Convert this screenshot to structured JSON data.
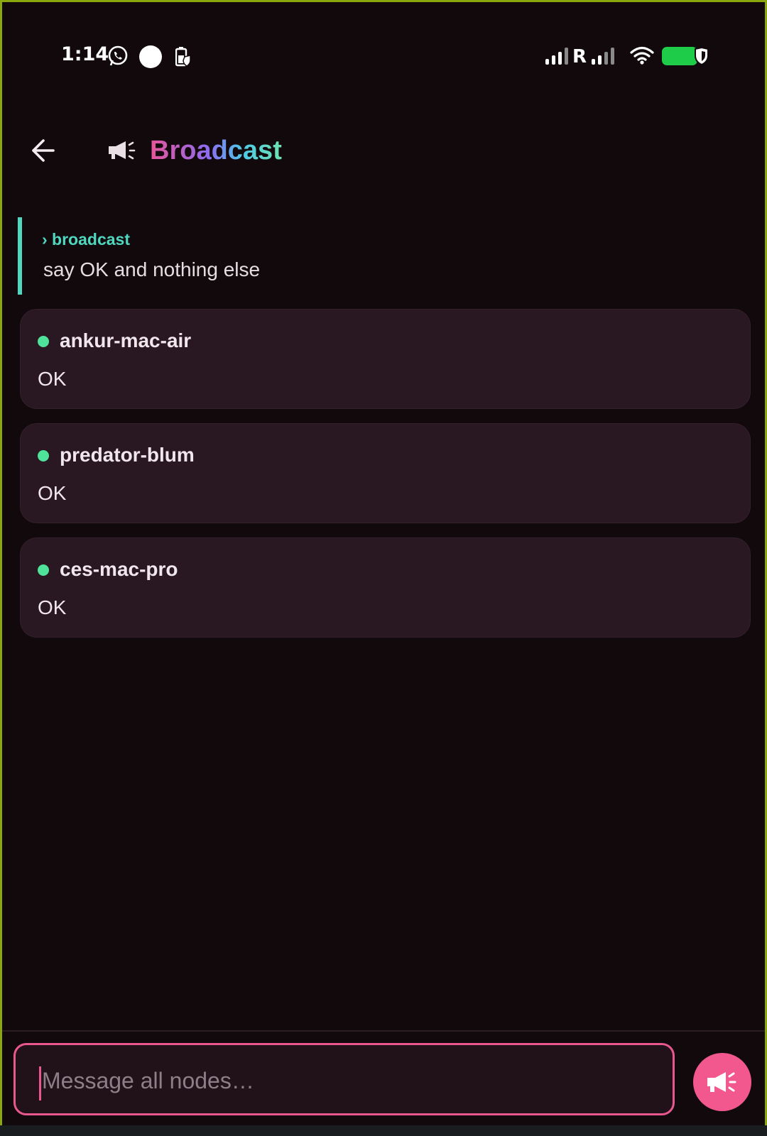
{
  "status_bar": {
    "time": "1:14",
    "roaming_label": "R",
    "icons": [
      "whatsapp-icon",
      "circle-icon",
      "battery-saver-icon",
      "signal-icon",
      "signal-icon",
      "wifi-icon",
      "battery-icon",
      "shield-icon"
    ]
  },
  "header": {
    "title": "Broadcast",
    "icons": [
      "back-arrow-icon",
      "megaphone-icon"
    ]
  },
  "prompt": {
    "label": "› broadcast",
    "text": "say OK and nothing else"
  },
  "responses": [
    {
      "node": "ankur-mac-air",
      "reply": "OK"
    },
    {
      "node": "predator-blum",
      "reply": "OK"
    },
    {
      "node": "ces-mac-pro",
      "reply": "OK"
    }
  ],
  "composer": {
    "placeholder": "Message all nodes…",
    "send_icon": "megaphone-icon"
  },
  "colors": {
    "background": "#12090d",
    "card": "#291821",
    "accent": "#f2588d",
    "online": "#4fe29a",
    "quote": "#4fd8c0"
  }
}
